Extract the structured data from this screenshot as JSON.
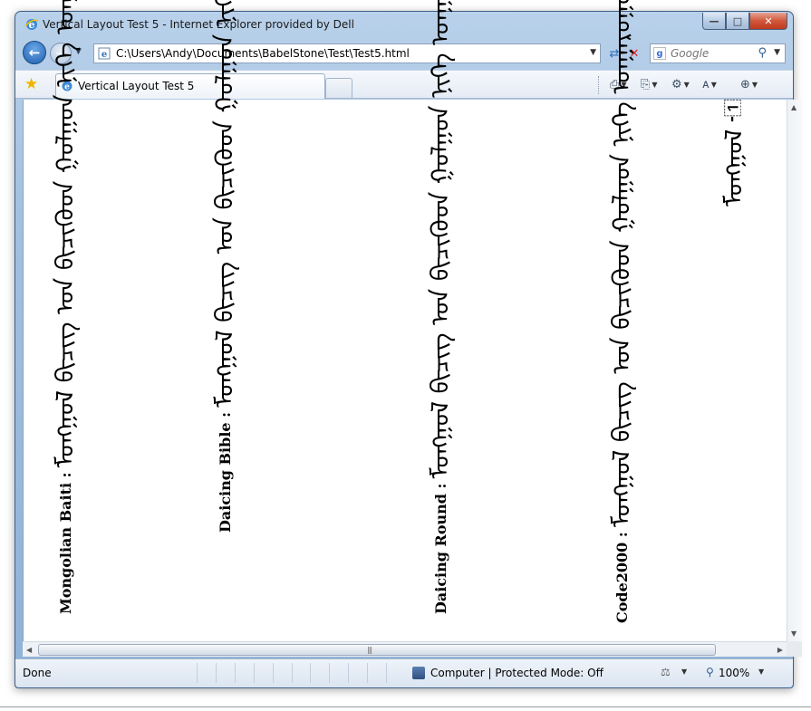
{
  "window": {
    "title": "Vertical Layout Test 5 - Internet Explorer provided by Dell",
    "caption_min": "—",
    "caption_max": "□",
    "caption_close": "✕"
  },
  "address_bar": {
    "url": "C:\\Users\\Andy\\Documents\\BabelStone\\Test\\Test5.html",
    "search_placeholder": "Google",
    "search_logo": "g"
  },
  "tabs": {
    "active_label": "Vertical Layout Test 5"
  },
  "content": {
    "columns": [
      {
        "label": "",
        "text": "ᠮᠣᠩᠭᠤᠯ ᠊᠋"
      },
      {
        "label": "Code2000 :",
        "text": "ᠮᠣᠩᠭᠤᠯ ᠪᠢᠴᠢᠭ ᠤᠨ ᠪᠢᠴᠢᠭᠦᠳ ᠭᠣᠯᠭᠣᠨ ᠨᠢᠭᠡ ᠤᠨᠭᠠᠷᠤᠭᠤᠨ᠊"
      },
      {
        "label": "Daicing Round :",
        "text": "ᠮᠣᠩᠭᠤᠯ ᠪᠢᠴᠢᠭ ᠤᠨ ᠪᠢᠴᠢᠭᠦᠳ ᠭᠣᠯᠭᠣᠨ ᠨᠢᠭᠡ ᠤᠨᠭᠠᠷᠤᠭᠤᠨ᠊"
      },
      {
        "label": "Daicing Bible :",
        "text": "ᠮᠣᠩᠭᠤᠯ ᠪᠢᠴᠢᠭ ᠤᠨ ᠪᠢᠴᠢᠭᠦᠳ ᠭᠣᠯᠭᠣᠨ ᠨᠢᠭᠡ ᠤᠨᠭᠠᠷᠤᠭᠤᠨ᠊"
      },
      {
        "label": "Mongolian Baiti :",
        "text": "ᠮᠣᠩᠭᠤᠯ ᠪᠢᠴᠢᠭ ᠤᠨ ᠪᠢᠴᠢᠭᠦᠳ ᠭᠣᠯᠭᠣᠨ ᠨᠢᠭᠡ ᠤᠨᠭᠠᠷᠤᠭᠤᠨ᠊"
      }
    ]
  },
  "status_bar": {
    "status": "Done",
    "zone": "Computer | Protected Mode: Off",
    "zoom": "100%"
  },
  "colors": {
    "window_frame": "#a3c0e0",
    "close_button": "#c0391d",
    "accent": "#2c5d93"
  }
}
